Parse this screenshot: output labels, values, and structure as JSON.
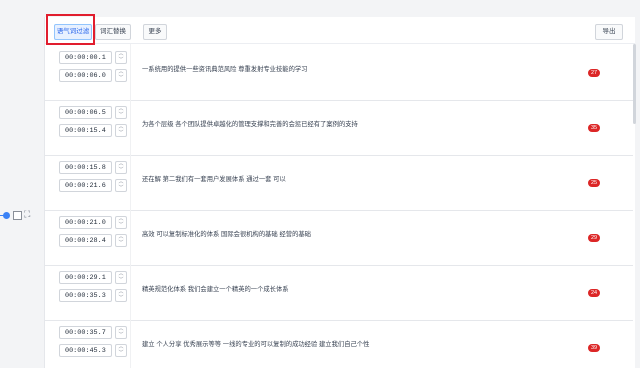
{
  "toolbar": {
    "filter_label": "语气词过滤",
    "replace_label": "词汇替换",
    "more_label": "更多",
    "export_label": "导出"
  },
  "rows": [
    {
      "start": "00:00:00.1",
      "end": "00:00:06.0",
      "text": "一系统用的提供一些资讯典范风险 尊重发射专业技能的学习",
      "count": "27"
    },
    {
      "start": "00:00:06.5",
      "end": "00:00:15.4",
      "text": "为各个层级 各个团队提供卓越化的管理支撑和完善的会惩已经有了案例的支持",
      "count": "35"
    },
    {
      "start": "00:00:15.8",
      "end": "00:00:21.6",
      "text": "还在解 第二我们有一套用户发展体系 通过一套 可以",
      "count": "25"
    },
    {
      "start": "00:00:21.0",
      "end": "00:00:28.4",
      "text": "高效 可以复制标准化的体系 国际会很机构的基础 经营的基础",
      "count": "29"
    },
    {
      "start": "00:00:29.1",
      "end": "00:00:35.3",
      "text": "精英规范化体系 我们会建立一个精英的一个成长体系",
      "count": "24"
    },
    {
      "start": "00:00:35.7",
      "end": "00:00:45.3",
      "text": "建立 个人分享 优秀展示等等 一线的专业的可以复制的成功经验 建立我们自己个性",
      "count": "39"
    }
  ]
}
